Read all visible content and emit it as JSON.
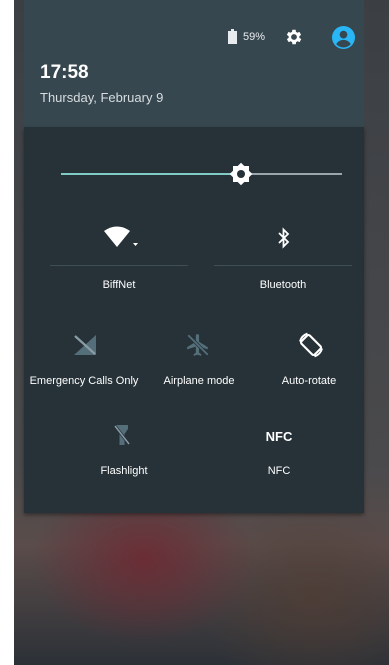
{
  "status": {
    "battery_percent": "59%",
    "icons": [
      "battery-icon",
      "gear-icon",
      "account-icon"
    ]
  },
  "header": {
    "time": "17:58",
    "date": "Thursday, February 9"
  },
  "brightness": {
    "level_fraction": 0.63
  },
  "tiles": {
    "wifi": {
      "label": "BiffNet",
      "icon": "wifi-icon"
    },
    "bluetooth": {
      "label": "Bluetooth",
      "icon": "bluetooth-icon"
    },
    "signal": {
      "label": "Emergency Calls Only",
      "icon": "no-signal-icon"
    },
    "airplane": {
      "label": "Airplane mode",
      "icon": "airplane-icon"
    },
    "rotate": {
      "label": "Auto-rotate",
      "icon": "auto-rotate-icon"
    },
    "flashlight": {
      "label": "Flashlight",
      "icon": "flashlight-icon"
    },
    "nfc": {
      "label": "NFC",
      "icon_text": "NFC"
    }
  },
  "colors": {
    "header_bg": "#37474f",
    "panel_bg": "#263238",
    "accent": "#80cbc4",
    "avatar": "#29b6f6"
  }
}
